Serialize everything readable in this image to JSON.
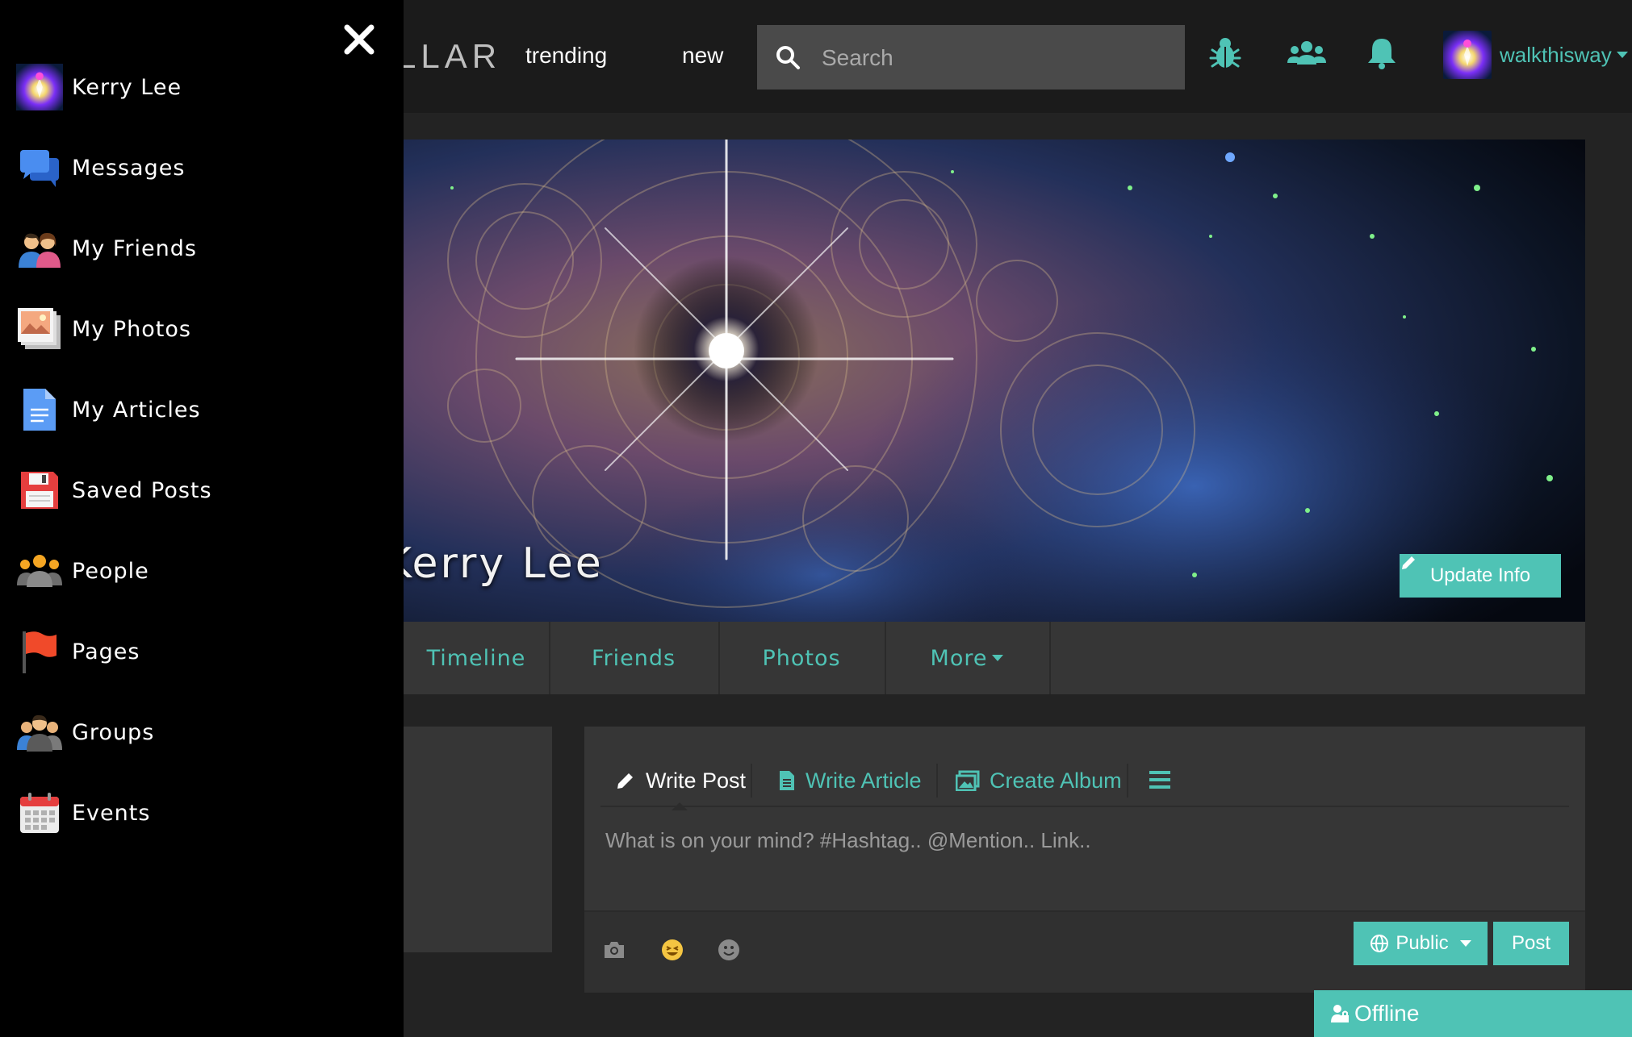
{
  "header": {
    "brand_partial": "LLAR",
    "nav": [
      "trending",
      "new"
    ],
    "search_placeholder": "Search",
    "username": "walkthisway",
    "icons": [
      "bug-icon",
      "groups-icon",
      "bell-icon"
    ]
  },
  "drawer": {
    "close_icon": "close-icon",
    "items": [
      {
        "label": "Kerry Lee",
        "icon": "avatar"
      },
      {
        "label": "Messages",
        "icon": "messages-icon"
      },
      {
        "label": "My Friends",
        "icon": "friends-icon"
      },
      {
        "label": "My Photos",
        "icon": "photos-icon"
      },
      {
        "label": "My Articles",
        "icon": "articles-icon"
      },
      {
        "label": "Saved Posts",
        "icon": "floppy-disk-icon"
      },
      {
        "label": "People",
        "icon": "people-icon"
      },
      {
        "label": "Pages",
        "icon": "flag-icon"
      },
      {
        "label": "Groups",
        "icon": "groups-icon"
      },
      {
        "label": "Events",
        "icon": "calendar-icon"
      }
    ]
  },
  "profile": {
    "name_partial": "Kerry Lee",
    "update_label": "Update Info",
    "tabs": [
      "Timeline",
      "Friends",
      "Photos",
      "More"
    ]
  },
  "composer": {
    "tabs": [
      "Write Post",
      "Write Article",
      "Create Album"
    ],
    "placeholder": "What is on your mind? #Hashtag.. @Mention.. Link..",
    "privacy_label": "Public",
    "post_label": "Post"
  },
  "chat": {
    "status": "Offline"
  },
  "colors": {
    "accent": "#4fc3b5",
    "background": "#232323",
    "panel": "#363636",
    "drawer": "#000000"
  }
}
